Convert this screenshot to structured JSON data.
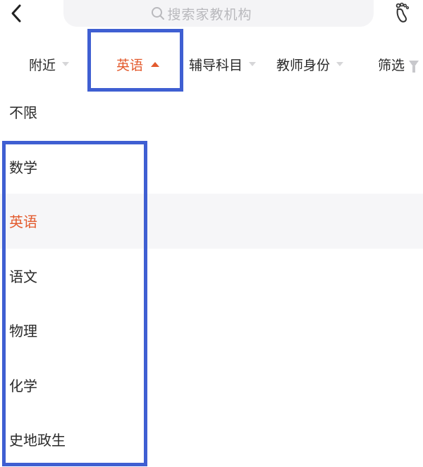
{
  "header": {
    "search_placeholder": "搜索家教机构",
    "icons": {
      "back": "chevron-left-icon",
      "search": "search-icon",
      "footprint": "footprint-icon"
    }
  },
  "filters": [
    {
      "label": "附近",
      "state": "collapsed"
    },
    {
      "label": "英语",
      "state": "expanded"
    },
    {
      "label": "辅导科目",
      "state": "collapsed"
    },
    {
      "label": "教师身份",
      "state": "collapsed"
    },
    {
      "label": "筛选",
      "state": "funnel"
    }
  ],
  "subject_options": [
    "不限",
    "数学",
    "英语",
    "语文",
    "物理",
    "化学",
    "史地政生"
  ],
  "selected_option": "英语",
  "colors": {
    "accent": "#e35a2d",
    "annotation_box": "#3f5fd2",
    "selected_row_bg": "#f6f6f8",
    "search_bg": "#f4f4f6"
  }
}
